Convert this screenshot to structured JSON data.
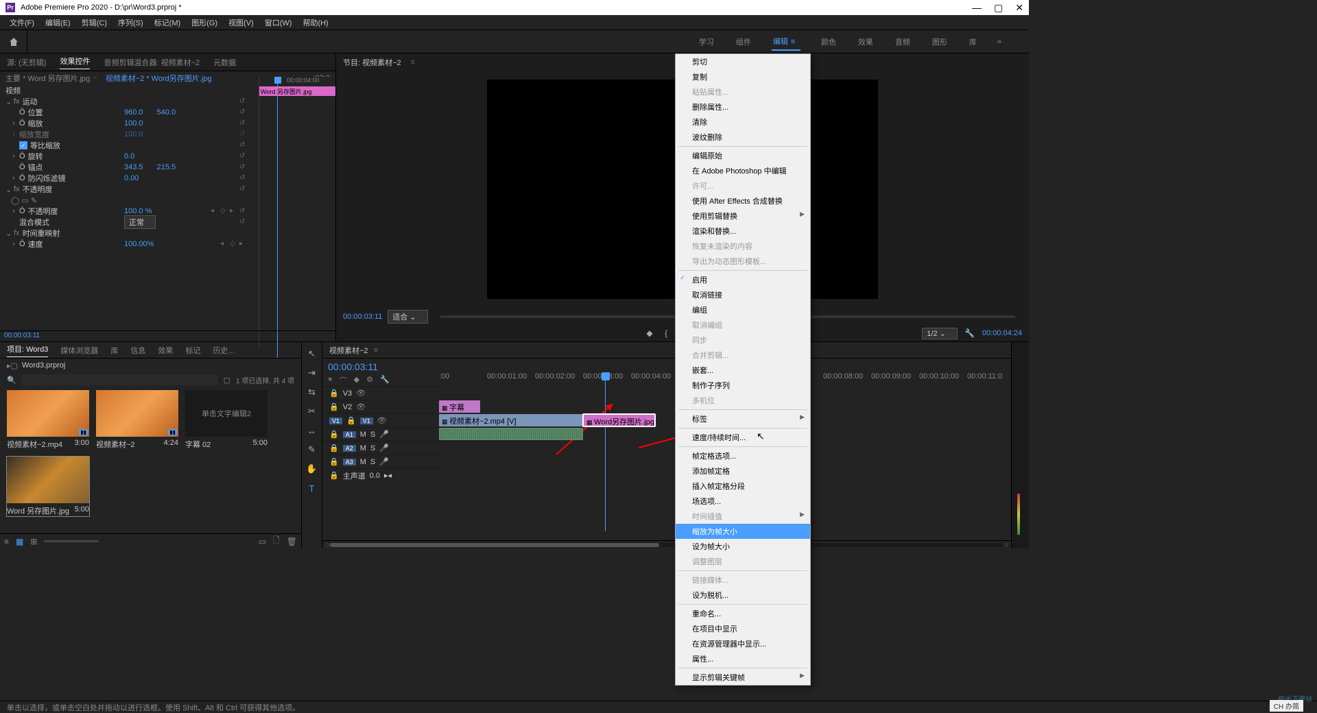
{
  "titlebar": {
    "app": "Adobe Premiere Pro 2020",
    "path": "D:\\pr\\Word3.prproj *"
  },
  "menu": [
    "文件(F)",
    "编辑(E)",
    "剪辑(C)",
    "序列(S)",
    "标记(M)",
    "图形(G)",
    "视图(V)",
    "窗口(W)",
    "帮助(H)"
  ],
  "workspace": {
    "tabs": [
      "学习",
      "组件",
      "编辑",
      "颜色",
      "效果",
      "音频",
      "图形",
      "库"
    ],
    "active": 2
  },
  "source_tabs": {
    "source": "源: (无剪辑)",
    "ec": "效果控件",
    "mixer": "音频剪辑混合器: 视频素材~2",
    "meta": "元数据"
  },
  "ec": {
    "master": "主要 * Word 另存图片.jpg",
    "dropdown": "视频素材~2 * Word另存图片.jpg",
    "head_tc_in": ":03:0",
    "head_tc": "00:00:04:00",
    "mini_clip": "Word 另存图片.jpg",
    "sections": {
      "video": "视频",
      "motion": "运动",
      "position": "位置",
      "pos_x": "960.0",
      "pos_y": "540.0",
      "scale": "缩放",
      "scale_v": "100.0",
      "scale_w": "缩放宽度",
      "scale_w_v": "100.0",
      "uniform": "等比缩放",
      "rotation": "旋转",
      "rotation_v": "0.0",
      "anchor": "锚点",
      "anchor_x": "343.5",
      "anchor_y": "215.5",
      "flicker": "防闪烁滤镜",
      "flicker_v": "0.00",
      "opacity": "不透明度",
      "opacity_prop": "不透明度",
      "opacity_v": "100.0 %",
      "blend": "混合模式",
      "blend_v": "正常",
      "remap": "时间重映射",
      "speed": "速度",
      "speed_v": "100.00%"
    },
    "bottom_tc": "00:00:03:11"
  },
  "program": {
    "title": "节目: 视频素材~2",
    "tc_left": "00:00:03:11",
    "fit": "适合",
    "ratio": "1/2",
    "tc_right": "00:00:04:24"
  },
  "project": {
    "tabs": [
      "项目: Word3",
      "媒体浏览器",
      "库",
      "信息",
      "效果",
      "标记",
      "历史…"
    ],
    "bin": "Word3.prproj",
    "count": "1 项已选择, 共 4 项",
    "items": [
      {
        "name": "视频素材~2.mp4",
        "dur": "3:00",
        "type": "vid"
      },
      {
        "name": "视频素材~2",
        "dur": "4:24",
        "type": "seq"
      },
      {
        "name": "字幕 02",
        "dur": "5:00",
        "type": "cap",
        "caption_text": "单击文字编辑2"
      },
      {
        "name": "Word 另存图片.jpg",
        "dur": "5:00",
        "type": "img"
      }
    ]
  },
  "timeline": {
    "title": "视频素材~2",
    "tc": "00:00:03:11",
    "ticks": [
      ":00",
      "00:00:01:00",
      "00:00:02:00",
      "00:00:03:00",
      "00:00:04:00",
      "00:00:08:00",
      "00:00:09:00",
      "00:00:10:00",
      "00:00:11:0"
    ],
    "tracks": {
      "v3": "V3",
      "v2": "V2",
      "v1": "V1",
      "a1": "A1",
      "a2": "A2",
      "a3": "A3",
      "master": "主声道",
      "m": "M",
      "s": "S",
      "o": "0.0"
    },
    "clips": {
      "caption": "字幕",
      "video": "视频素材~2.mp4 [V]",
      "image": "Word另存图片.jpg"
    }
  },
  "context": {
    "items": [
      {
        "t": "剪切"
      },
      {
        "t": "复制"
      },
      {
        "t": "粘贴属性...",
        "d": true
      },
      {
        "t": "删除属性..."
      },
      {
        "t": "清除"
      },
      {
        "t": "波纹删除"
      },
      {
        "sep": true
      },
      {
        "t": "编辑原始"
      },
      {
        "t": "在 Adobe Photoshop 中编辑"
      },
      {
        "t": "许可...",
        "d": true
      },
      {
        "t": "使用 After Effects 合成替换"
      },
      {
        "t": "使用剪辑替换",
        "arrow": true
      },
      {
        "t": "渲染和替换..."
      },
      {
        "t": "恢复未渲染的内容",
        "d": true
      },
      {
        "t": "导出为动态图形模板...",
        "d": true
      },
      {
        "sep": true
      },
      {
        "t": "启用",
        "check": true
      },
      {
        "t": "取消链接"
      },
      {
        "t": "编组"
      },
      {
        "t": "取消编组",
        "d": true
      },
      {
        "t": "同步",
        "d": true
      },
      {
        "t": "合并剪辑...",
        "d": true
      },
      {
        "t": "嵌套..."
      },
      {
        "t": "制作子序列"
      },
      {
        "t": "多机位",
        "d": true
      },
      {
        "sep": true
      },
      {
        "t": "标签",
        "arrow": true
      },
      {
        "sep": true
      },
      {
        "t": "速度/持续时间..."
      },
      {
        "sep": true
      },
      {
        "t": "帧定格选项..."
      },
      {
        "t": "添加帧定格"
      },
      {
        "t": "插入帧定格分段"
      },
      {
        "t": "场选项..."
      },
      {
        "t": "时间插值",
        "d": true,
        "arrow": true
      },
      {
        "t": "缩放为帧大小",
        "hl": true
      },
      {
        "t": "设为帧大小"
      },
      {
        "t": "调整图层",
        "d": true
      },
      {
        "sep": true
      },
      {
        "t": "链接媒体...",
        "d": true
      },
      {
        "t": "设为脱机..."
      },
      {
        "sep": true
      },
      {
        "t": "重命名..."
      },
      {
        "t": "在项目中显示"
      },
      {
        "t": "在资源管理器中显示..."
      },
      {
        "t": "属性..."
      },
      {
        "sep": true
      },
      {
        "t": "显示剪辑关键帧",
        "arrow": true
      }
    ]
  },
  "status": "单击以选择，或单击空白处并拖动以进行选框。使用 Shift、Alt 和 Ctrl 可获得其他选项。",
  "ime": "CH 办简"
}
